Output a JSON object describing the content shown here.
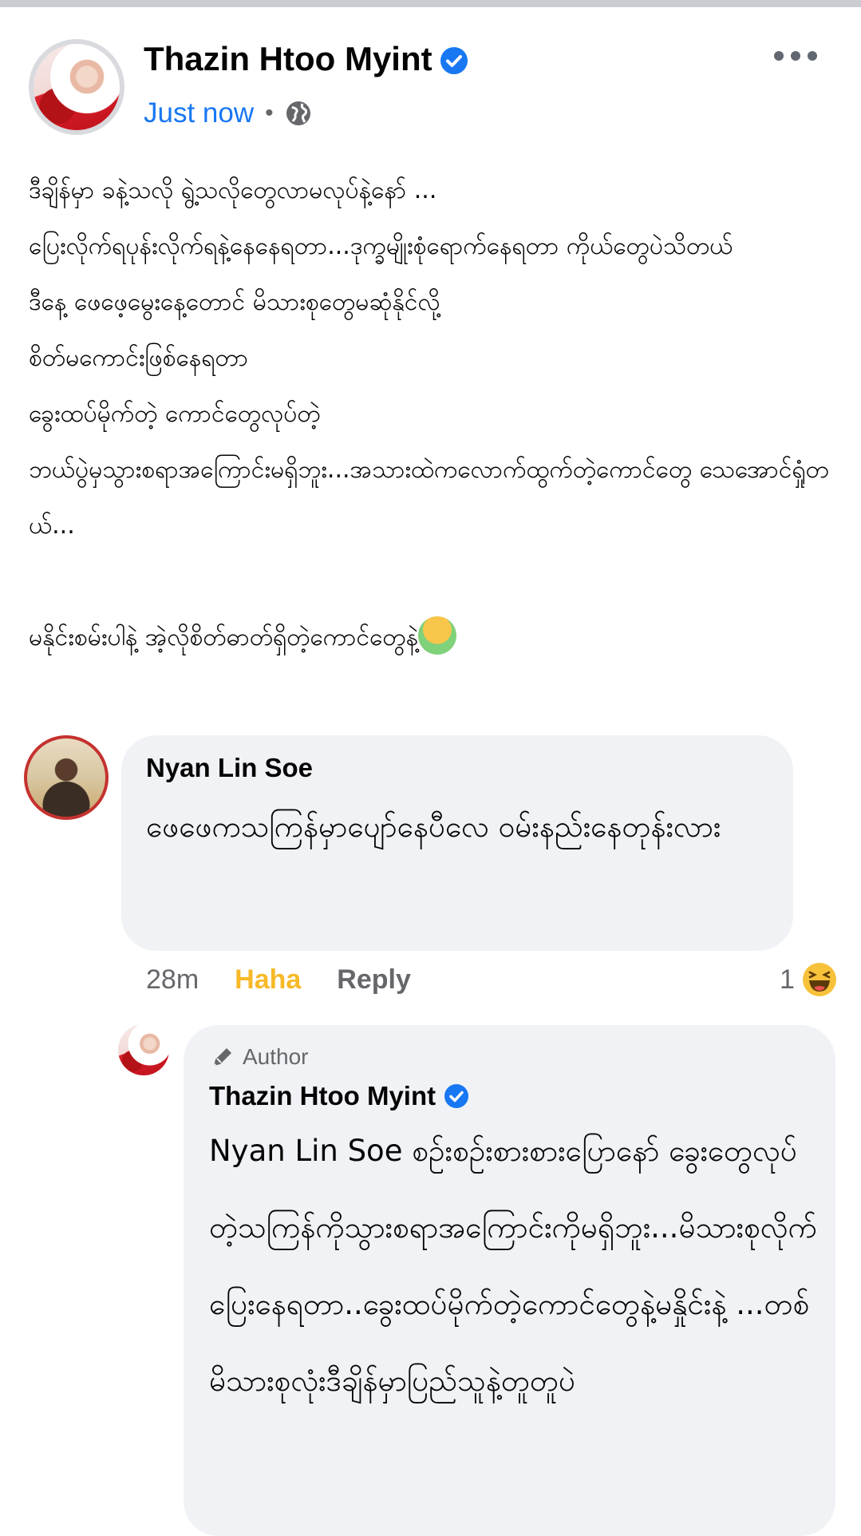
{
  "post": {
    "author": "Thazin Htoo Myint",
    "time": "Just now",
    "separator": "•",
    "lines": [
      "ဒီချိန်မှာ ခနဲ့သလို ရွဲ့သလိုတွေလာမလုပ်နဲ့နော် ...",
      "ပြေးလိုက်ရပုန်းလိုက်ရနဲ့နေနေရတာ...ဒုက္ခမျိုးစုံရောက်နေရတာ ကိုယ်တွေပဲသိတယ်",
      "ဒီနေ့ ဖေဖေ့မွေးနေ့တောင် မိသားစုတွေမဆုံနိုင်လို့",
      "စိတ်မကောင်းဖြစ်နေရတာ",
      "ခွေးထပ်မိုက်တဲ့ ကောင်တွေလုပ်တဲ့",
      "ဘယ်ပွဲမှသွားစရာအကြောင်းမရှိဘူး...အသားထဲကလောက်ထွက်တဲ့ကောင်တွေ သေအောင်ရှုံတယ်...",
      "",
      "မနိုင်းစမ်းပါနဲ့ အဲ့လိုစိတ်ဓာတ်ရှိတဲ့ကောင်တွေနဲ့"
    ]
  },
  "comment": {
    "author": "Nyan Lin Soe",
    "text": "ဖေဖေကသကြန်မှာပျော်နေပီလေ ဝမ်းနည်းနေတုန်းလား",
    "time": "28m",
    "reaction_label": "Haha",
    "reply_label": "Reply",
    "reaction_count": "1"
  },
  "reply": {
    "badge": "Author",
    "author": "Thazin Htoo Myint",
    "text": "Nyan Lin Soe စဉ်းစဉ်းစားစားပြောနော် ခွေးတွေလုပ်တဲ့သကြန်ကိုသွားစရာအကြောင်းကိုမရှိဘူး...မိသားစုလိုက်ပြေးနေရတာ..ခွေးထပ်မိုက်တဲ့ကောင်တွေနဲ့မနှိုင်းနဲ့ ...တစ်မိသားစုလုံးဒီချိန်မှာပြည်သူနဲ့တူတူပဲ"
  },
  "colors": {
    "link_blue": "#1877f2",
    "haha_yellow": "#f7b928",
    "bubble_bg": "#f0f2f5",
    "secondary_text": "#65676b"
  },
  "icons": {
    "verified": "verified-badge-icon",
    "audience": "globe-icon",
    "more": "more-options-icon",
    "haha": "haha-reaction-icon",
    "author_badge": "pen-icon",
    "emoji": "nauseated-face-emoji"
  }
}
